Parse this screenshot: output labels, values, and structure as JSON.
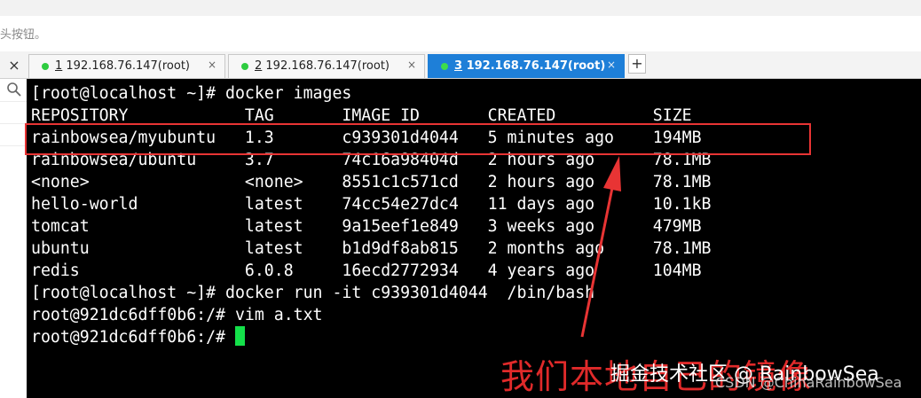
{
  "hint_text": "头按钮。",
  "tabs": [
    {
      "num": "1",
      "host": " 192.168.76.147(root)",
      "active": false
    },
    {
      "num": "2",
      "host": " 192.168.76.147(root)",
      "active": false
    },
    {
      "num": "3",
      "host": " 192.168.76.147(root)",
      "active": true
    }
  ],
  "tab_close_glyph": "×",
  "add_tab_glyph": "+",
  "terminal": {
    "lines": [
      "[root@localhost ~]# docker images",
      "REPOSITORY            TAG       IMAGE ID       CREATED          SIZE",
      "rainbowsea/myubuntu   1.3       c939301d4044   5 minutes ago    194MB",
      "rainbowsea/ubuntu     3.7       74c16a98404d   2 hours ago      78.1MB",
      "<none>                <none>    8551c1c571cd   2 hours ago      78.1MB",
      "hello-world           latest    74cc54e27dc4   11 days ago      10.1kB",
      "tomcat                latest    9a15eef1e849   3 weeks ago      479MB",
      "ubuntu                latest    b1d9df8ab815   2 months ago     78.1MB",
      "redis                 6.0.8     16ecd2772934   4 years ago      104MB",
      "[root@localhost ~]# docker run -it c939301d4044  /bin/bash",
      "root@921dc6dff0b6:/# vim a.txt",
      "root@921dc6dff0b6:/# "
    ],
    "cursor_color": "#14e04a"
  },
  "annotation": "我们本地自己的镜像",
  "watermark_top": "掘金技术社区 @ RainbowSea",
  "watermark_bottom": "CSDN @ChinaRainbowSea",
  "colors": {
    "accent_tab": "#1e7fd8",
    "status_dot": "#2ecc40",
    "annotation_red": "#e02a2a",
    "terminal_bg": "#000000"
  }
}
